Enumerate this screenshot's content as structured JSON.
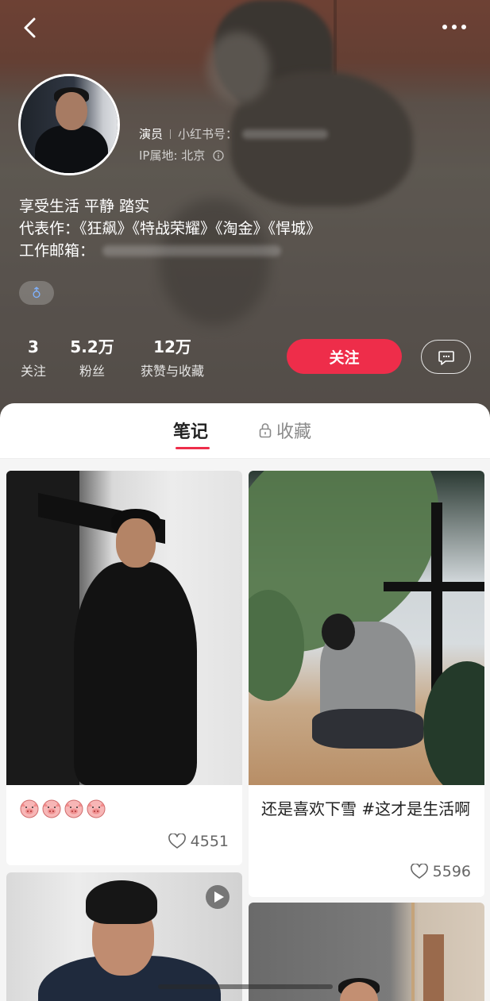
{
  "profile": {
    "role": "演员",
    "id_label": "小红书号：",
    "ip_location": "IP属地: 北京",
    "bio_line1": "享受生活 平静 踏实",
    "bio_line2": "代表作：《狂飙》《特战荣耀》《淘金》《悍城》",
    "bio_line3_label": "工作邮箱：",
    "gender_icon": "male-icon"
  },
  "stats": [
    {
      "value": "3",
      "label": "关注"
    },
    {
      "value": "5.2万",
      "label": "粉丝"
    },
    {
      "value": "12万",
      "label": "获赞与收藏"
    }
  ],
  "actions": {
    "follow_label": "关注",
    "message_icon": "chat-bubble-icon"
  },
  "tabs": [
    {
      "label": "笔记",
      "active": true
    },
    {
      "label": "收藏",
      "locked": true
    }
  ],
  "posts": [
    {
      "caption_emoji_count": 4,
      "likes": "4551"
    },
    {
      "caption": "还是喜欢下雪 #这才是生活啊",
      "likes": "5596"
    },
    {
      "is_video": true
    },
    {}
  ],
  "colors": {
    "accent": "#ee2d4a"
  }
}
